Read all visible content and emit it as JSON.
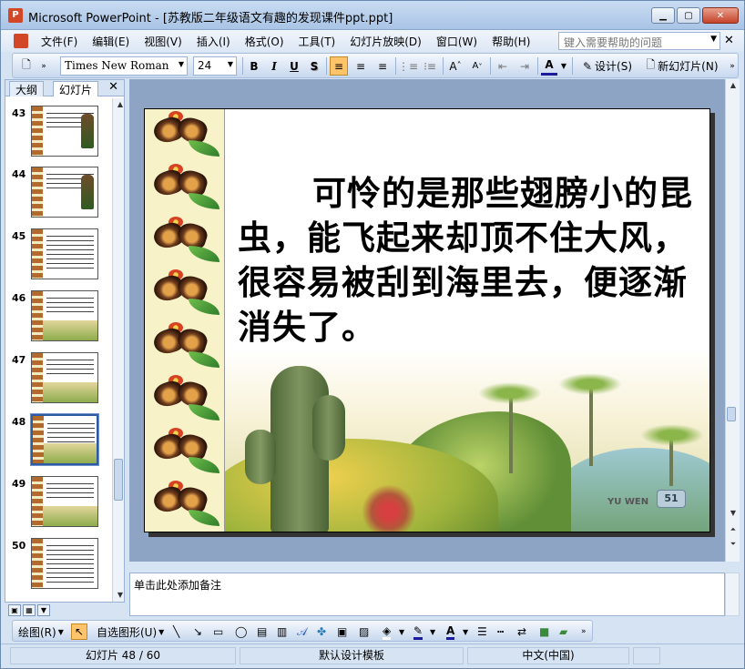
{
  "window": {
    "title": "Microsoft PowerPoint - [苏教版二年级语文有趣的发现课件ppt.ppt]"
  },
  "menu": {
    "items": [
      "文件(F)",
      "编辑(E)",
      "视图(V)",
      "插入(I)",
      "格式(O)",
      "工具(T)",
      "幻灯片放映(D)",
      "窗口(W)",
      "帮助(H)"
    ],
    "help_placeholder": "键入需要帮助的问题"
  },
  "toolbar": {
    "font": "Times New Roman",
    "size": "24",
    "bold": "B",
    "italic": "I",
    "underline": "U",
    "shadow": "S",
    "design_label": "设计(S)",
    "new_slide_label": "新幻灯片(N)"
  },
  "left_panel": {
    "tabs": [
      "大纲",
      "幻灯片"
    ],
    "slides": [
      "43",
      "44",
      "45",
      "46",
      "47",
      "48",
      "49",
      "50"
    ],
    "selected": "48"
  },
  "slide": {
    "text": "可怜的是那些翅膀小的昆虫，能飞起来却顶不住大风，很容易被刮到海里去，便逐渐消失了。",
    "footer_brand": "YU WEN",
    "page_number": "51"
  },
  "notes": {
    "placeholder": "单击此处添加备注"
  },
  "drawing_toolbar": {
    "draw_label": "绘图(R)",
    "autoshapes_label": "自选图形(U)"
  },
  "status": {
    "slide_info": "幻灯片 48 / 60",
    "template": "默认设计模板",
    "language": "中文(中国)"
  },
  "colors": {
    "accent": "#ffc46a",
    "frame": "#6b8ab0"
  }
}
